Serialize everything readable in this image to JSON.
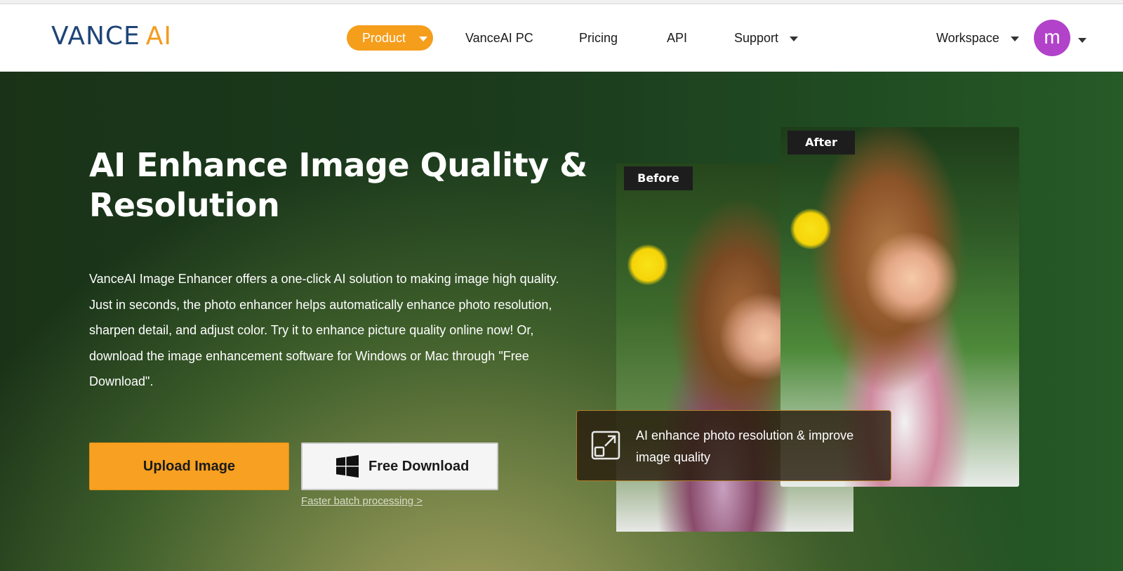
{
  "logo": {
    "part1": "VANCE",
    "part2": "AI"
  },
  "nav": {
    "product": "Product",
    "pc": "VanceAI PC",
    "pricing": "Pricing",
    "api": "API",
    "support": "Support",
    "workspace": "Workspace"
  },
  "user": {
    "avatar_letter": "m",
    "avatar_color": "#b142c9"
  },
  "hero": {
    "title": "AI Enhance Image Quality & Resolution",
    "description": "VanceAI Image Enhancer offers a one-click AI solution to making image high quality. Just in seconds, the photo enhancer helps automatically enhance photo resolution, sharpen detail, and adjust color. Try it to enhance picture quality online now! Or, download the image enhancement software for Windows or Mac through \"Free Download\".",
    "upload_label": "Upload Image",
    "download_label": "Free Download",
    "batch_link": "Faster batch processing >"
  },
  "comparison": {
    "before_label": "Before",
    "after_label": "After",
    "caption": "AI enhance photo resolution & improve image quality"
  },
  "colors": {
    "accent": "#f59e1c",
    "brand_blue": "#1f4577",
    "hero_bg": "#1b3b1d"
  },
  "icons": [
    "chevron-down-icon",
    "windows-icon",
    "expand-icon"
  ]
}
